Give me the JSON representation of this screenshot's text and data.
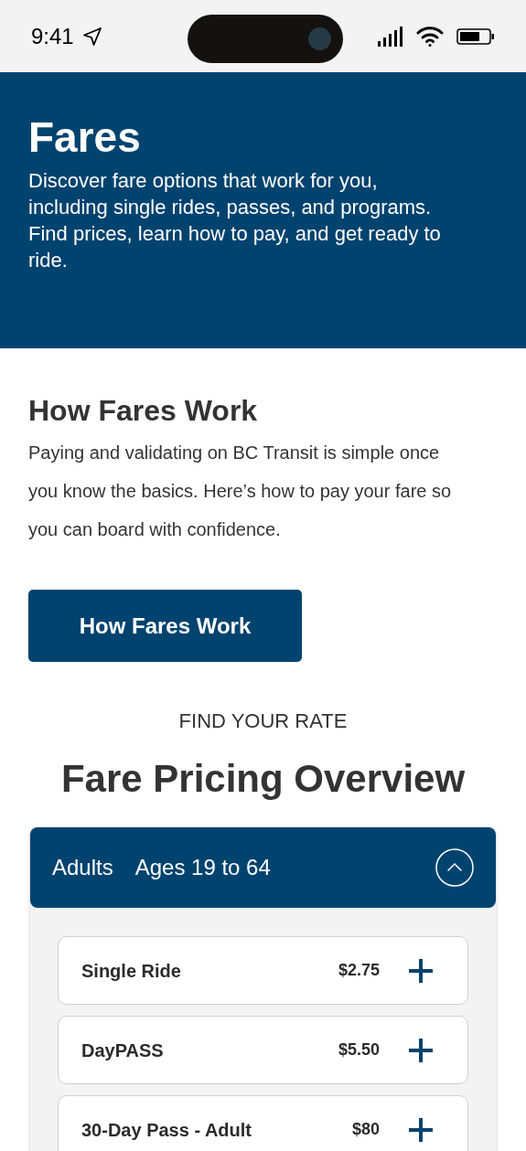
{
  "status_bar": {
    "time": "9:41"
  },
  "hero": {
    "title": "Fares",
    "description": "Discover fare options that work for you, including single rides, passes, and programs. Find prices, learn how to pay, and get ready to ride."
  },
  "how_fares_work": {
    "heading": "How Fares Work",
    "body": "Paying and validating on BC Transit is simple once you know the basics. Here’s how to pay your fare so you can board with confidence.",
    "button": "How Fares Work"
  },
  "pricing": {
    "eyebrow": "FIND YOUR RATE",
    "heading": "Fare Pricing Overview",
    "groups": [
      {
        "name": "Adults",
        "ages": "Ages 19 to 64",
        "expanded": true,
        "fares": [
          {
            "name": "Single Ride",
            "price": "$2.75",
            "expanded": false
          },
          {
            "name": "DayPASS",
            "price": "$5.50",
            "expanded": false
          },
          {
            "name": "30-Day Pass - Adult",
            "price": "$80",
            "expanded": false
          }
        ]
      }
    ]
  }
}
